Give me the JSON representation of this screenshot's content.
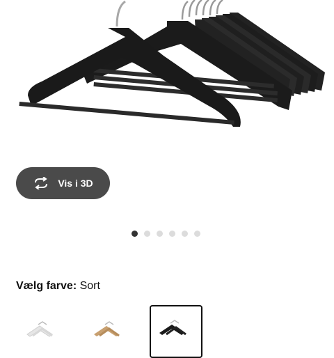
{
  "product": {
    "image_alt": "black coat hangers",
    "view_3d_label": "Vis i 3D",
    "carousel": {
      "total": 6,
      "active": 0
    }
  },
  "color": {
    "label": "Vælg farve:",
    "selected": "Sort",
    "options": [
      {
        "name": "white-hangers",
        "color": "#eeeeee"
      },
      {
        "name": "natural-hangers",
        "color": "#c8a070"
      },
      {
        "name": "black-hangers",
        "color": "#1a1a1a"
      }
    ]
  },
  "colors": {
    "button_bg": "#4a4a4a",
    "hanger": "#1e1e1e"
  }
}
